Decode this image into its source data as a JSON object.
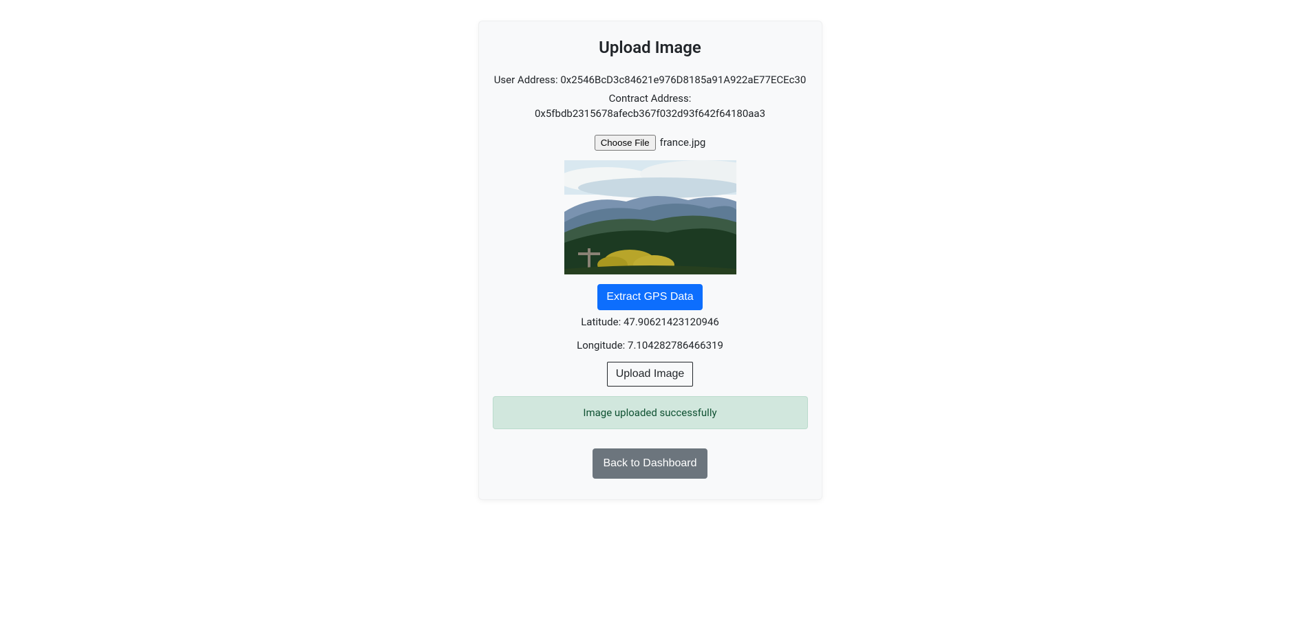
{
  "title": "Upload Image",
  "user_address_label": "User Address: ",
  "user_address": "0x2546BcD3c84621e976D8185a91A922aE77ECEc30",
  "contract_address_label": "Contract Address: ",
  "contract_address": "0x5fbdb2315678afecb367f032d93f642f64180aa3",
  "file_button_label": "Choose File",
  "file_name": "france.jpg",
  "extract_button_label": "Extract GPS Data",
  "latitude_label": "Latitude: ",
  "latitude": "47.90621423120946",
  "longitude_label": "Longitude: ",
  "longitude": "7.104282786466319",
  "upload_button_label": "Upload Image",
  "success_message": "Image uploaded successfully",
  "back_button_label": "Back to Dashboard"
}
